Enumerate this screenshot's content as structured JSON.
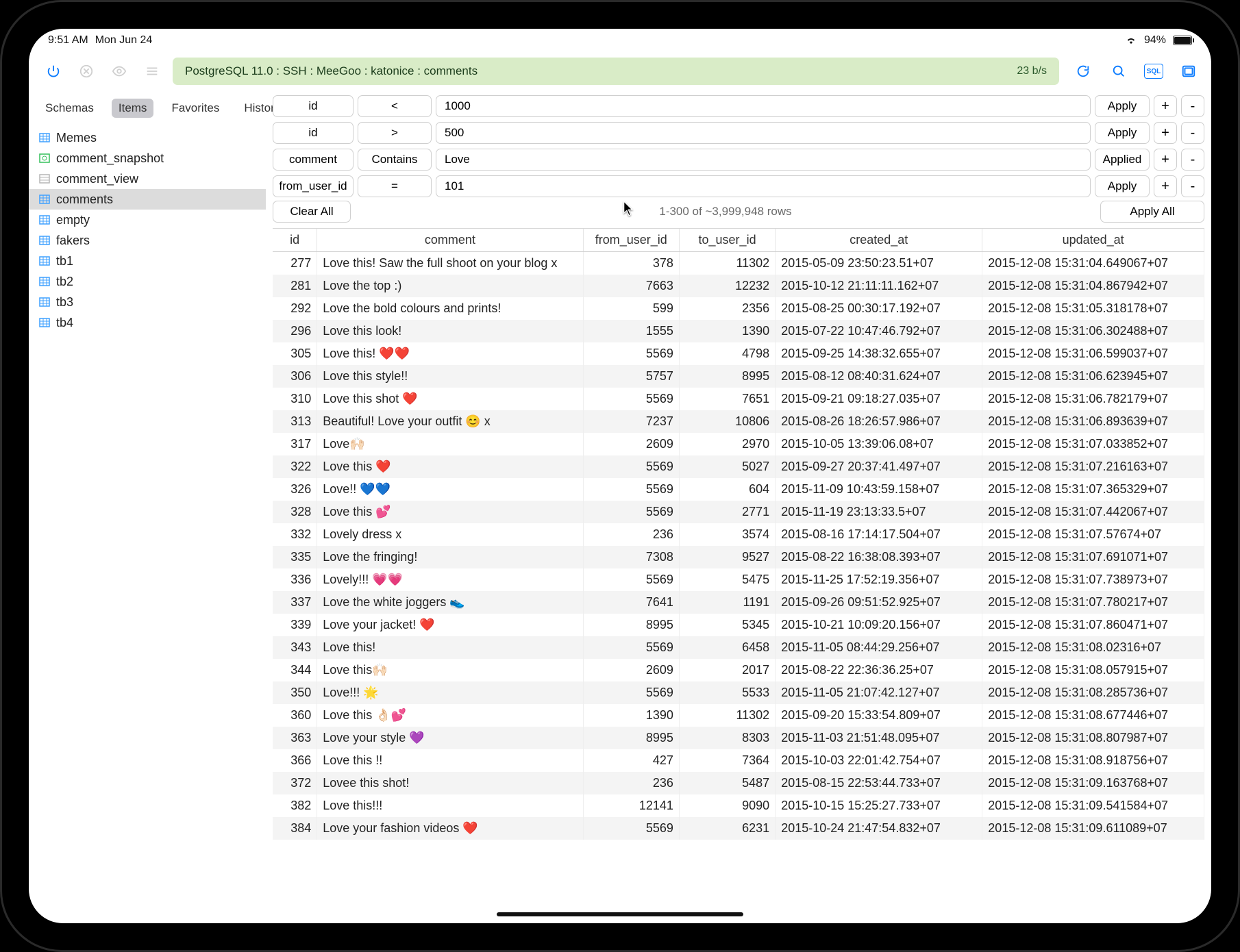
{
  "statusbar": {
    "time": "9:51 AM",
    "date": "Mon Jun 24",
    "battery": "94%"
  },
  "breadcrumb": {
    "text": "PostgreSQL 11.0 : SSH : MeeGoo : katonice : comments",
    "rate": "23 b/s"
  },
  "sidebar": {
    "tabs": {
      "schemas": "Schemas",
      "items": "Items",
      "favorites": "Favorites",
      "history": "History"
    },
    "items": [
      {
        "label": "Memes",
        "icon": "table",
        "selected": false
      },
      {
        "label": "comment_snapshot",
        "icon": "snapshot",
        "selected": false
      },
      {
        "label": "comment_view",
        "icon": "view",
        "selected": false
      },
      {
        "label": "comments",
        "icon": "table",
        "selected": true
      },
      {
        "label": "empty",
        "icon": "table",
        "selected": false
      },
      {
        "label": "fakers",
        "icon": "table",
        "selected": false
      },
      {
        "label": "tb1",
        "icon": "table",
        "selected": false
      },
      {
        "label": "tb2",
        "icon": "table",
        "selected": false
      },
      {
        "label": "tb3",
        "icon": "table",
        "selected": false
      },
      {
        "label": "tb4",
        "icon": "table",
        "selected": false
      }
    ]
  },
  "filters": {
    "rows": [
      {
        "column": "id",
        "op": "<",
        "value": "1000",
        "action": "Apply"
      },
      {
        "column": "id",
        "op": ">",
        "value": "500",
        "action": "Apply"
      },
      {
        "column": "comment",
        "op": "Contains",
        "value": "Love",
        "action": "Applied"
      },
      {
        "column": "from_user_id",
        "op": "=",
        "value": "101",
        "action": "Apply"
      }
    ],
    "clear": "Clear All",
    "summary": "1-300 of ~3,999,948 rows",
    "applyall": "Apply All",
    "plus": "+",
    "minus": "-"
  },
  "table": {
    "headers": {
      "id": "id",
      "comment": "comment",
      "from_user_id": "from_user_id",
      "to_user_id": "to_user_id",
      "created_at": "created_at",
      "updated_at": "updated_at"
    },
    "rows": [
      {
        "id": "277",
        "comment": "Love this! Saw the full shoot on your blog x",
        "from_user_id": "378",
        "to_user_id": "11302",
        "created_at": "2015-05-09 23:50:23.51+07",
        "updated_at": "2015-12-08 15:31:04.649067+07"
      },
      {
        "id": "281",
        "comment": "Love the top :)",
        "from_user_id": "7663",
        "to_user_id": "12232",
        "created_at": "2015-10-12 21:11:11.162+07",
        "updated_at": "2015-12-08 15:31:04.867942+07"
      },
      {
        "id": "292",
        "comment": "Love the bold colours and prints!",
        "from_user_id": "599",
        "to_user_id": "2356",
        "created_at": "2015-08-25 00:30:17.192+07",
        "updated_at": "2015-12-08 15:31:05.318178+07"
      },
      {
        "id": "296",
        "comment": "Love this look!",
        "from_user_id": "1555",
        "to_user_id": "1390",
        "created_at": "2015-07-22 10:47:46.792+07",
        "updated_at": "2015-12-08 15:31:06.302488+07"
      },
      {
        "id": "305",
        "comment": "Love this! ❤️❤️",
        "from_user_id": "5569",
        "to_user_id": "4798",
        "created_at": "2015-09-25 14:38:32.655+07",
        "updated_at": "2015-12-08 15:31:06.599037+07"
      },
      {
        "id": "306",
        "comment": "Love this style!!",
        "from_user_id": "5757",
        "to_user_id": "8995",
        "created_at": "2015-08-12 08:40:31.624+07",
        "updated_at": "2015-12-08 15:31:06.623945+07"
      },
      {
        "id": "310",
        "comment": "Love this shot ❤️",
        "from_user_id": "5569",
        "to_user_id": "7651",
        "created_at": "2015-09-21 09:18:27.035+07",
        "updated_at": "2015-12-08 15:31:06.782179+07"
      },
      {
        "id": "313",
        "comment": "Beautiful! Love your outfit 😊 x",
        "from_user_id": "7237",
        "to_user_id": "10806",
        "created_at": "2015-08-26 18:26:57.986+07",
        "updated_at": "2015-12-08 15:31:06.893639+07"
      },
      {
        "id": "317",
        "comment": " Love🙌🏻",
        "from_user_id": "2609",
        "to_user_id": "2970",
        "created_at": "2015-10-05 13:39:06.08+07",
        "updated_at": "2015-12-08 15:31:07.033852+07"
      },
      {
        "id": "322",
        "comment": "Love this ❤️",
        "from_user_id": "5569",
        "to_user_id": "5027",
        "created_at": "2015-09-27 20:37:41.497+07",
        "updated_at": "2015-12-08 15:31:07.216163+07"
      },
      {
        "id": "326",
        "comment": "Love!! 💙💙",
        "from_user_id": "5569",
        "to_user_id": "604",
        "created_at": "2015-11-09 10:43:59.158+07",
        "updated_at": "2015-12-08 15:31:07.365329+07"
      },
      {
        "id": "328",
        "comment": "Love this 💕",
        "from_user_id": "5569",
        "to_user_id": "2771",
        "created_at": "2015-11-19 23:13:33.5+07",
        "updated_at": "2015-12-08 15:31:07.442067+07"
      },
      {
        "id": "332",
        "comment": "Lovely dress x",
        "from_user_id": "236",
        "to_user_id": "3574",
        "created_at": "2015-08-16 17:14:17.504+07",
        "updated_at": "2015-12-08 15:31:07.57674+07"
      },
      {
        "id": "335",
        "comment": "Love the fringing!",
        "from_user_id": "7308",
        "to_user_id": "9527",
        "created_at": "2015-08-22 16:38:08.393+07",
        "updated_at": "2015-12-08 15:31:07.691071+07"
      },
      {
        "id": "336",
        "comment": "Lovely!!! 💗💗",
        "from_user_id": "5569",
        "to_user_id": "5475",
        "created_at": "2015-11-25 17:52:19.356+07",
        "updated_at": "2015-12-08 15:31:07.738973+07"
      },
      {
        "id": "337",
        "comment": "Love the white joggers 👟",
        "from_user_id": "7641",
        "to_user_id": "1191",
        "created_at": "2015-09-26 09:51:52.925+07",
        "updated_at": "2015-12-08 15:31:07.780217+07"
      },
      {
        "id": "339",
        "comment": "Love your jacket! ❤️",
        "from_user_id": "8995",
        "to_user_id": "5345",
        "created_at": "2015-10-21 10:09:20.156+07",
        "updated_at": "2015-12-08 15:31:07.860471+07"
      },
      {
        "id": "343",
        "comment": "Love this!",
        "from_user_id": "5569",
        "to_user_id": "6458",
        "created_at": "2015-11-05 08:44:29.256+07",
        "updated_at": "2015-12-08 15:31:08.02316+07"
      },
      {
        "id": "344",
        "comment": "Love this🙌🏻",
        "from_user_id": "2609",
        "to_user_id": "2017",
        "created_at": "2015-08-22 22:36:36.25+07",
        "updated_at": "2015-12-08 15:31:08.057915+07"
      },
      {
        "id": "350",
        "comment": "Love!!! 🌟",
        "from_user_id": "5569",
        "to_user_id": "5533",
        "created_at": "2015-11-05 21:07:42.127+07",
        "updated_at": "2015-12-08 15:31:08.285736+07"
      },
      {
        "id": "360",
        "comment": "Love this 👌🏻💕",
        "from_user_id": "1390",
        "to_user_id": "11302",
        "created_at": "2015-09-20 15:33:54.809+07",
        "updated_at": "2015-12-08 15:31:08.677446+07"
      },
      {
        "id": "363",
        "comment": "Love your style 💜",
        "from_user_id": "8995",
        "to_user_id": "8303",
        "created_at": "2015-11-03 21:51:48.095+07",
        "updated_at": "2015-12-08 15:31:08.807987+07"
      },
      {
        "id": "366",
        "comment": "Love this !!",
        "from_user_id": "427",
        "to_user_id": "7364",
        "created_at": "2015-10-03 22:01:42.754+07",
        "updated_at": "2015-12-08 15:31:08.918756+07"
      },
      {
        "id": "372",
        "comment": "Lovee this shot!",
        "from_user_id": "236",
        "to_user_id": "5487",
        "created_at": "2015-08-15 22:53:44.733+07",
        "updated_at": "2015-12-08 15:31:09.163768+07"
      },
      {
        "id": "382",
        "comment": "Love this!!!",
        "from_user_id": "12141",
        "to_user_id": "9090",
        "created_at": "2015-10-15 15:25:27.733+07",
        "updated_at": "2015-12-08 15:31:09.541584+07"
      },
      {
        "id": "384",
        "comment": "Love your fashion videos ❤️",
        "from_user_id": "5569",
        "to_user_id": "6231",
        "created_at": "2015-10-24 21:47:54.832+07",
        "updated_at": "2015-12-08 15:31:09.611089+07"
      }
    ]
  }
}
